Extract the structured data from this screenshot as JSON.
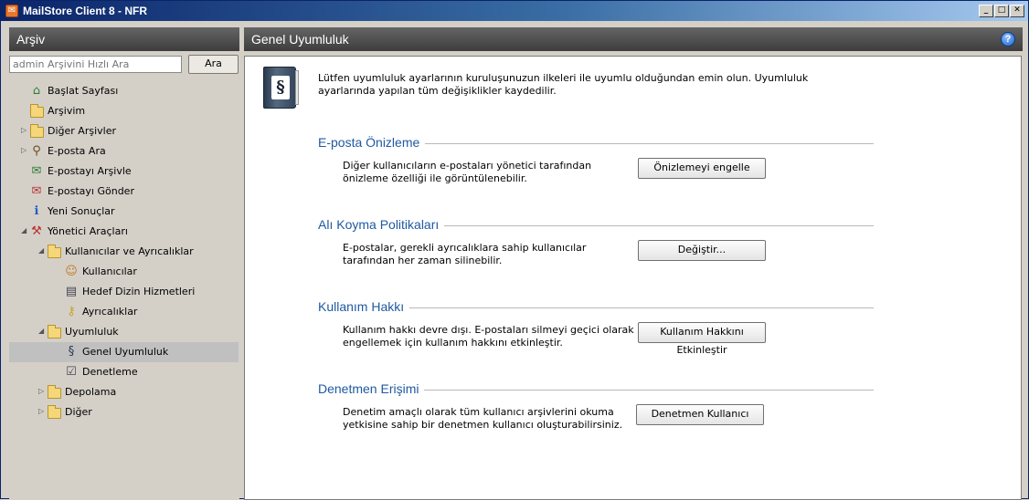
{
  "window": {
    "title": "MailStore Client 8 - NFR"
  },
  "left": {
    "header": "Arşiv",
    "search": {
      "placeholder": "admin Arşivini Hızlı Ara",
      "button": "Ara"
    },
    "tree": [
      {
        "label": "Başlat Sayfası",
        "icon": "home-icon",
        "level": 0,
        "expander": ""
      },
      {
        "label": "Arşivim",
        "icon": "folder-icon",
        "level": 0,
        "expander": ""
      },
      {
        "label": "Diğer Arşivler",
        "icon": "folder-icon",
        "level": 0,
        "expander": "collapsed"
      },
      {
        "label": "E-posta Ara",
        "icon": "magnifier-icon",
        "level": 0,
        "expander": "collapsed"
      },
      {
        "label": "E-postayı Arşivle",
        "icon": "archive-email-icon",
        "level": 0,
        "expander": ""
      },
      {
        "label": "E-postayı Gönder",
        "icon": "send-email-icon",
        "level": 0,
        "expander": ""
      },
      {
        "label": "Yeni Sonuçlar",
        "icon": "info-icon",
        "level": 0,
        "expander": ""
      },
      {
        "label": "Yönetici Araçları",
        "icon": "admin-tools-icon",
        "level": 0,
        "expander": "expanded"
      },
      {
        "label": "Kullanıcılar ve Ayrıcalıklar",
        "icon": "folder-icon",
        "level": 1,
        "expander": "expanded"
      },
      {
        "label": "Kullanıcılar",
        "icon": "user-icon",
        "level": 2,
        "expander": ""
      },
      {
        "label": "Hedef Dizin Hizmetleri",
        "icon": "directory-services-icon",
        "level": 2,
        "expander": ""
      },
      {
        "label": "Ayrıcalıklar",
        "icon": "key-icon",
        "level": 2,
        "expander": ""
      },
      {
        "label": "Uyumluluk",
        "icon": "folder-icon",
        "level": 1,
        "expander": "expanded"
      },
      {
        "label": "Genel Uyumluluk",
        "icon": "law-book-icon",
        "level": 2,
        "expander": "",
        "selected": true
      },
      {
        "label": "Denetleme",
        "icon": "audit-icon",
        "level": 2,
        "expander": ""
      },
      {
        "label": "Depolama",
        "icon": "folder-icon",
        "level": 1,
        "expander": "collapsed"
      },
      {
        "label": "Diğer",
        "icon": "folder-icon",
        "level": 1,
        "expander": "collapsed"
      }
    ]
  },
  "main": {
    "header": "Genel Uyumluluk",
    "intro": "Lütfen uyumluluk ayarlarının kuruluşunuzun ilkeleri ile uyumlu olduğundan emin olun. Uyumluluk ayarlarında yapılan tüm değişiklikler kaydedilir.",
    "sections": [
      {
        "title": "E-posta Önizleme",
        "description": "Diğer kullanıcıların e-postaları yönetici tarafından önizleme özelliği ile görüntülenebilir.",
        "button": "Önizlemeyi engelle"
      },
      {
        "title": "Alı Koyma Politikaları",
        "description": "E-postalar, gerekli ayrıcalıklara sahip kullanıcılar tarafından her zaman silinebilir.",
        "button": "Değiştir..."
      },
      {
        "title": "Kullanım Hakkı",
        "description": "Kullanım hakkı devre dışı. E-postaları silmeyi geçici olarak engellemek için kullanım hakkını etkinleştir.",
        "button": "Kullanım Hakkını Etkinleştir"
      },
      {
        "title": "Denetmen Erişimi",
        "description": "Denetim amaçlı olarak tüm kullanıcı arşivlerini okuma yetkisine sahip bir denetmen kullanıcı oluşturabilirsiniz.",
        "button": "Denetmen Kullanıcı"
      }
    ]
  }
}
